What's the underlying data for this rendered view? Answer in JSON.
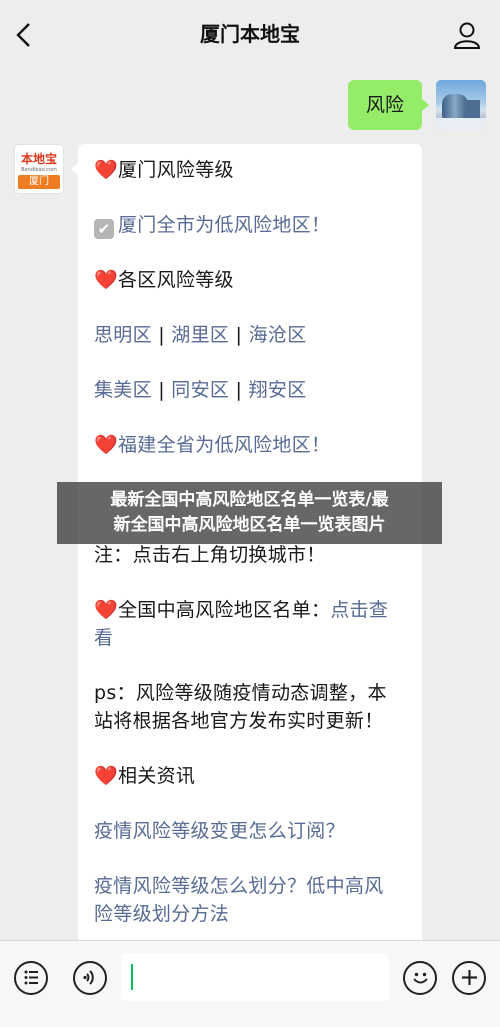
{
  "header": {
    "title": "厦门本地宝"
  },
  "user_message": {
    "text": "风险"
  },
  "bot_avatar": {
    "brand": "本地宝",
    "url": "Bendibao.com",
    "city": "厦门"
  },
  "bot_message": {
    "l1": "厦门风险等级",
    "l2": "厦门全市为低风险地区！",
    "l3": "各区风险等级",
    "d1": "思明区",
    "d2": "湖里区",
    "d3": "海沧区",
    "d4": "集美区",
    "d5": "同安区",
    "d6": "翔安区",
    "sep": "|",
    "l5": "福建全省为低风险地区！",
    "l6": "注：点击右上角切换城市！",
    "l7_prefix": "全国中高风险地区名单：",
    "l7_link_a": "点击查",
    "l7_link_b": "看",
    "l8a": "ps：风险等级随疫情动态调整，本",
    "l8b": "站将根据各地官方发布实时更新！",
    "l9": "相关资讯",
    "q1": "疫情风险等级变更怎么订阅？",
    "q2a": "疫情风险等级怎么划分？低中高风",
    "q2b": "险等级划分方法"
  },
  "watermark": {
    "line1": "最新全国中高风险地区名单一览表/最",
    "line2": "新全国中高风险地区名单一览表图片"
  },
  "icons": {
    "back": "chevron-left-icon",
    "profile": "person-icon",
    "menu": "list-icon",
    "voice": "voice-icon",
    "emoji": "smiley-icon",
    "plus": "plus-icon"
  },
  "colors": {
    "user_bubble": "#95ec69",
    "link": "#576b95",
    "heart": "#e0262e",
    "background": "#ededed"
  }
}
